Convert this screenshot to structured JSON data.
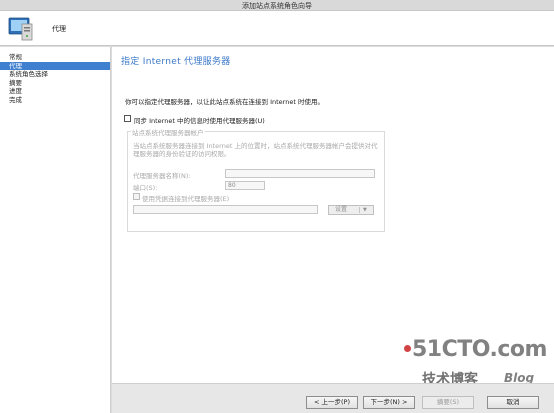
{
  "window": {
    "title": "添加站点系统角色向导"
  },
  "header": {
    "title": "代理"
  },
  "sidebar": {
    "items": [
      {
        "label": "常规",
        "active": false
      },
      {
        "label": "代理",
        "active": true
      },
      {
        "label": "系统角色选择",
        "active": false
      },
      {
        "label": "摘要",
        "active": false
      },
      {
        "label": "进度",
        "active": false
      },
      {
        "label": "完成",
        "active": false
      }
    ]
  },
  "main": {
    "title": "指定 Internet 代理服务器",
    "intro": "你可以指定代理服务器，以让此站点系统在连接到 Internet 时使用。",
    "use_proxy_checkbox": {
      "label": "同步 Internet 中的信息时使用代理服务器(U)",
      "checked": false
    },
    "group": {
      "title": "站点系统代理服务器帐户",
      "description": "当站点系统服务器连接到 Internet 上的位置时，站点系统代理服务器帐户会提供对代理服务器的身份验证的访问权限。",
      "proxy_name_label": "代理服务器名称(N):",
      "proxy_name_value": "",
      "port_label": "端口(S):",
      "port_value": "80",
      "credentials_checkbox": {
        "label": "使用凭据连接到代理服务器(E)",
        "checked": false
      },
      "account_value": "",
      "settings_button": "设置"
    }
  },
  "footer": {
    "prev": "< 上一步(P)",
    "next": "下一步(N) >",
    "summary": "摘要(S)",
    "cancel": "取消"
  },
  "watermark": {
    "brand": "51CTO.com",
    "sub": "技术博客",
    "blog": "Blog"
  },
  "colors": {
    "accent": "#3f7fcf",
    "title_blue": "#3a78c8"
  }
}
